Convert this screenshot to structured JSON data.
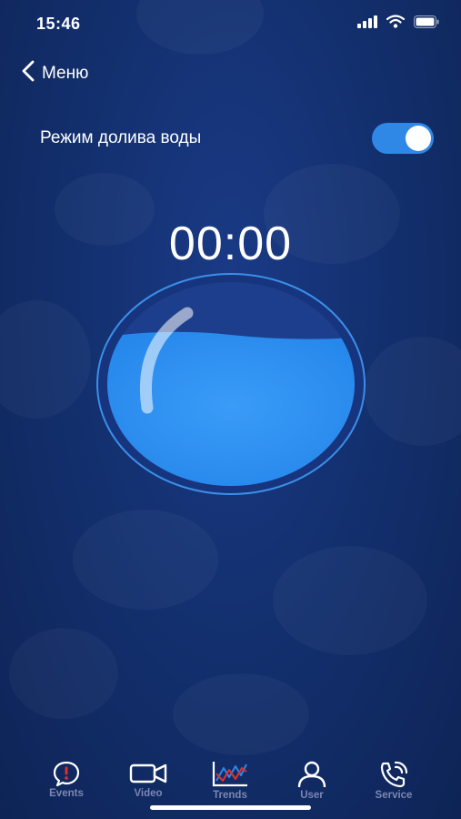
{
  "status_bar": {
    "time": "15:46"
  },
  "nav": {
    "back_label": "Меню"
  },
  "water_mode": {
    "label": "Режим долива воды",
    "enabled": true
  },
  "timer": {
    "value": "00:00"
  },
  "water_level": {
    "fill_fraction": 0.75
  },
  "tabs": [
    {
      "label": "Events",
      "icon": "alert-bubble-icon"
    },
    {
      "label": "Video",
      "icon": "video-camera-icon"
    },
    {
      "label": "Trends",
      "icon": "trend-chart-icon"
    },
    {
      "label": "User",
      "icon": "user-icon"
    },
    {
      "label": "Service",
      "icon": "phone-service-icon"
    }
  ],
  "colors": {
    "accent": "#2f88e6",
    "water": "#2a8df0",
    "tab_inactive": "#7b86b3",
    "alert": "#e0312f"
  }
}
